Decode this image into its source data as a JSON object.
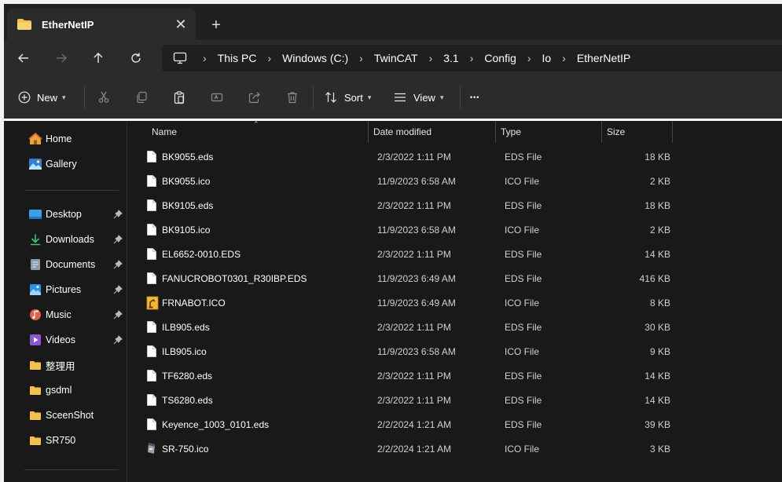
{
  "window": {
    "tab_title": "EtherNetIP",
    "new_tab_symbol": "+",
    "close_symbol": "✕"
  },
  "breadcrumbs": [
    "This PC",
    "Windows (C:)",
    "TwinCAT",
    "3.1",
    "Config",
    "Io",
    "EtherNetIP"
  ],
  "toolbar": {
    "new_label": "New",
    "sort_label": "Sort",
    "view_label": "View",
    "more_symbol": "•••"
  },
  "sidebar": {
    "quick": [
      {
        "label": "Home",
        "icon": "home-icon"
      },
      {
        "label": "Gallery",
        "icon": "gallery-icon"
      }
    ],
    "pinned": [
      {
        "label": "Desktop",
        "icon": "desktop-icon",
        "color": "#3aa0e8"
      },
      {
        "label": "Downloads",
        "icon": "download-icon",
        "color": "#3ec37a"
      },
      {
        "label": "Documents",
        "icon": "documents-icon",
        "color": "#8a9bb0"
      },
      {
        "label": "Pictures",
        "icon": "pictures-icon",
        "color": "#2f8fe0"
      },
      {
        "label": "Music",
        "icon": "music-icon",
        "color": "#e0604a"
      },
      {
        "label": "Videos",
        "icon": "videos-icon",
        "color": "#8a56d6"
      }
    ],
    "folders": [
      {
        "label": "整理用"
      },
      {
        "label": "gsdml"
      },
      {
        "label": "SceenShot"
      },
      {
        "label": "SR750"
      }
    ]
  },
  "columns": {
    "name": "Name",
    "date": "Date modified",
    "type": "Type",
    "size": "Size"
  },
  "files": [
    {
      "name": "BK9055.eds",
      "date": "2/3/2022 1:11 PM",
      "type": "EDS File",
      "size": "18 KB",
      "icon": "file-icon"
    },
    {
      "name": "BK9055.ico",
      "date": "11/9/2023 6:58 AM",
      "type": "ICO File",
      "size": "2 KB",
      "icon": "file-icon"
    },
    {
      "name": "BK9105.eds",
      "date": "2/3/2022 1:11 PM",
      "type": "EDS File",
      "size": "18 KB",
      "icon": "file-icon"
    },
    {
      "name": "BK9105.ico",
      "date": "11/9/2023 6:58 AM",
      "type": "ICO File",
      "size": "2 KB",
      "icon": "file-icon"
    },
    {
      "name": "EL6652-0010.EDS",
      "date": "2/3/2022 1:11 PM",
      "type": "EDS File",
      "size": "14 KB",
      "icon": "file-icon"
    },
    {
      "name": "FANUCROBOT0301_R30IBP.EDS",
      "date": "11/9/2023 6:49 AM",
      "type": "EDS File",
      "size": "416 KB",
      "icon": "file-icon"
    },
    {
      "name": "FRNABOT.ICO",
      "date": "11/9/2023 6:49 AM",
      "type": "ICO File",
      "size": "8 KB",
      "icon": "robot-ico-icon"
    },
    {
      "name": "ILB905.eds",
      "date": "2/3/2022 1:11 PM",
      "type": "EDS File",
      "size": "30 KB",
      "icon": "file-icon"
    },
    {
      "name": "ILB905.ico",
      "date": "11/9/2023 6:58 AM",
      "type": "ICO File",
      "size": "9 KB",
      "icon": "file-icon"
    },
    {
      "name": "TF6280.eds",
      "date": "2/3/2022 1:11 PM",
      "type": "EDS File",
      "size": "14 KB",
      "icon": "file-icon"
    },
    {
      "name": "TS6280.eds",
      "date": "2/3/2022 1:11 PM",
      "type": "EDS File",
      "size": "14 KB",
      "icon": "file-icon"
    },
    {
      "name": "Keyence_1003_0101.eds",
      "date": "2/2/2024 1:21 AM",
      "type": "EDS File",
      "size": "39 KB",
      "icon": "file-icon"
    },
    {
      "name": "SR-750.ico",
      "date": "2/2/2024 1:21 AM",
      "type": "ICO File",
      "size": "3 KB",
      "icon": "scanner-ico-icon"
    }
  ],
  "colors": {
    "folder": "#f2c14e",
    "accent": "#4cc2ff"
  }
}
